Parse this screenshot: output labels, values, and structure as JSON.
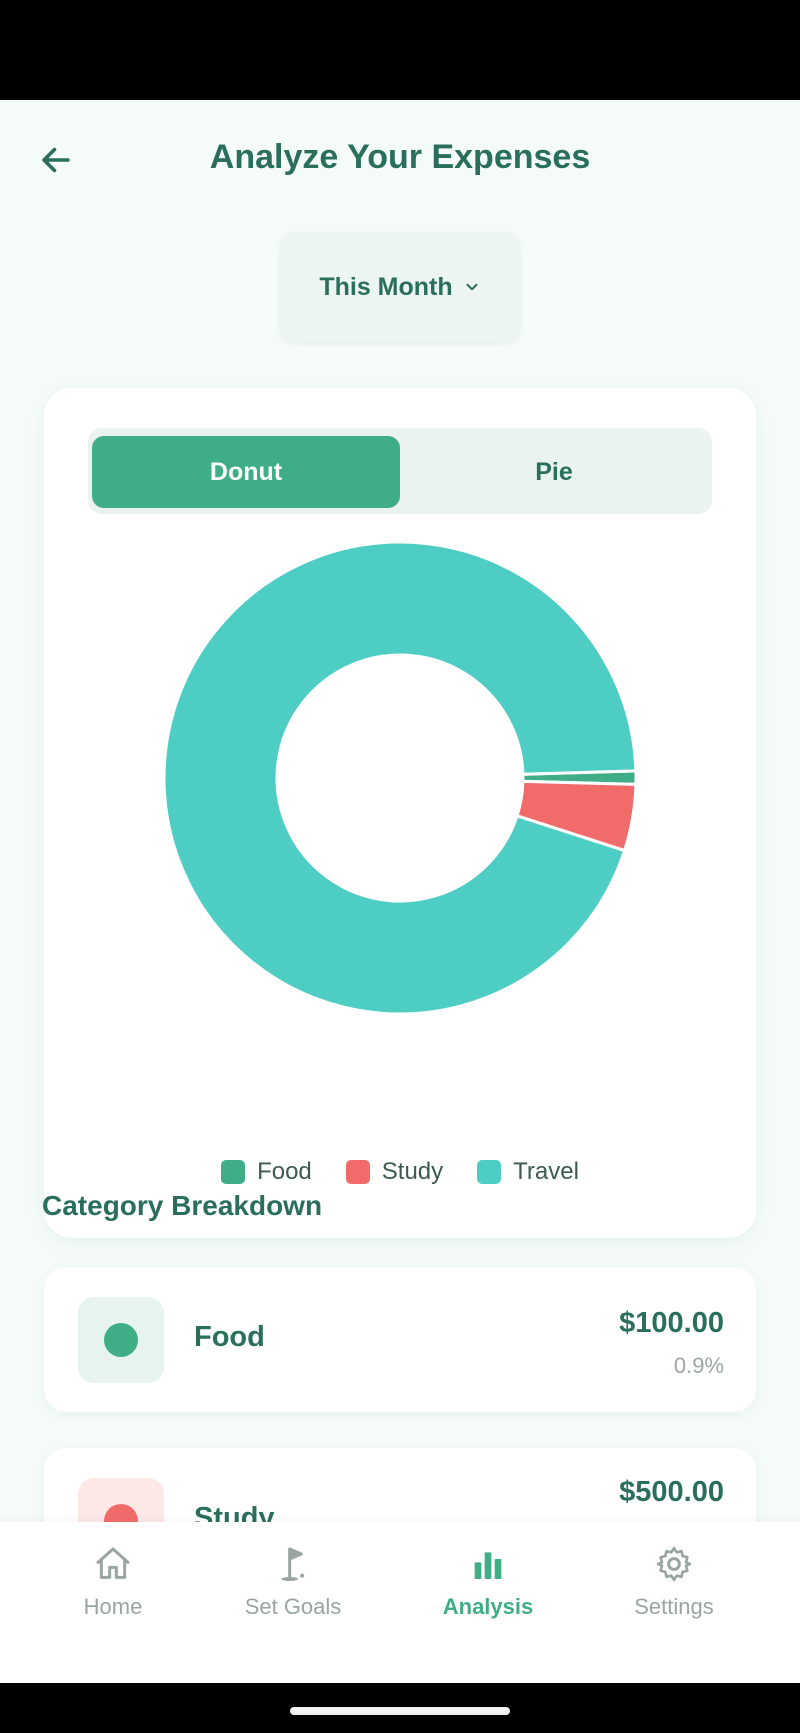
{
  "header": {
    "title": "Analyze Your Expenses",
    "back_icon": "arrow-left-icon"
  },
  "period": {
    "selected": "This Month"
  },
  "chart_toggle": {
    "options": [
      "Donut",
      "Pie"
    ],
    "selected": "Donut"
  },
  "colors": {
    "food": "#3fae86",
    "study": "#f26b6b",
    "travel": "#4ecdc4",
    "accent": "#2a6f5b"
  },
  "chart_data": {
    "type": "pie",
    "categories": [
      "Food",
      "Study",
      "Travel"
    ],
    "values": [
      100,
      500,
      10400
    ],
    "colors": [
      "#3fae86",
      "#f26b6b",
      "#4ecdc4"
    ],
    "legend": [
      "Food",
      "Study",
      "Travel"
    ],
    "legend_position": "bottom"
  },
  "breakdown": {
    "title": "Category Breakdown",
    "items": [
      {
        "name": "Food",
        "amount": "$100.00",
        "percent": "0.9%"
      },
      {
        "name": "Study",
        "amount": "$500.00",
        "percent": ""
      }
    ]
  },
  "nav": {
    "items": [
      {
        "label": "Home",
        "icon": "home-icon"
      },
      {
        "label": "Set Goals",
        "icon": "golf-flag-icon"
      },
      {
        "label": "Analysis",
        "icon": "bar-chart-icon"
      },
      {
        "label": "Settings",
        "icon": "gear-icon"
      }
    ],
    "active": "Analysis"
  }
}
